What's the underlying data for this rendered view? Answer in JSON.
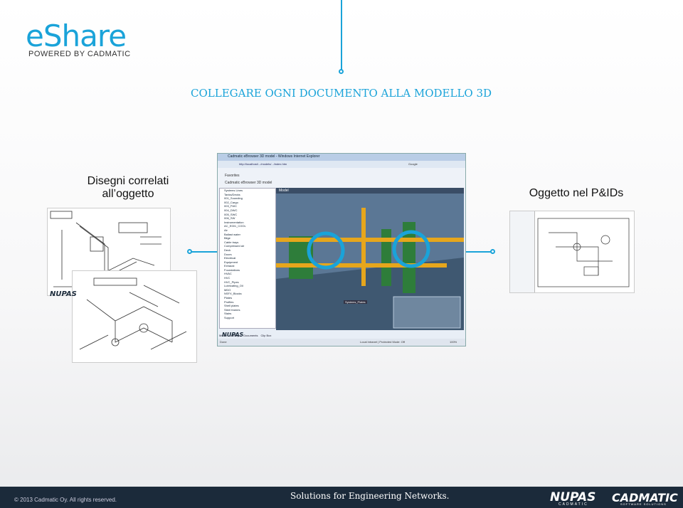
{
  "logo": {
    "name": "eShare",
    "tagline": "POWERED BY CADMATIC"
  },
  "title": "COLLEGARE OGNI DOCUMENTO ALLA MODELLO 3D",
  "left_label": "Disegni correlati\nall’oggetto",
  "right_label": "Oggetto nel P&IDs",
  "footer": {
    "copyright": "© 2013 Cadmatic Oy. All rights reserved.",
    "slogan": "Solutions for Engineering Networks.",
    "brand1": "NUPAS",
    "brand1_sub": "CADMATIC",
    "brand2": "CADMATIC",
    "brand2_sub": "SOFTWARE SOLUTIONS"
  },
  "screenshot": {
    "window_title": "Cadmatic eBrowser 3D model - Windows Internet Explorer",
    "url": "http://localhost/.../models/.../index.htm",
    "search_engine": "Google",
    "tab_label": "Cadmatic eBrowser 3D model",
    "favorites": "Favorites",
    "tree_items": [
      "Systems Lines",
      "Tanks/Decks",
      "001_Sounding",
      "002_Cargo",
      "003_FWC",
      "004_DWC",
      "005_SWC",
      "006_SW",
      "Instrumentation",
      "AC_E001_COOL",
      "Air",
      "Ballast water",
      "Bilge",
      "Cable trays",
      "Compressed air",
      "Deck",
      "Doors",
      "Electrical",
      "Equipment",
      "Exhaust",
      "Foundations",
      "HVAC",
      "HVC",
      "HVC_Pipes",
      "Lubricating_Oil",
      "MDO",
      "NSFX_Blocks",
      "Plates",
      "Profiles",
      "Shell plates",
      "Steel frames",
      "Stairs",
      "Support"
    ],
    "viewer_tab": "Model",
    "bottom_tabs": [
      "Model",
      "Markups",
      "Documents",
      "Clip Box"
    ],
    "status_left": "Done",
    "status_right": "Local intranet | Protected Mode: Off",
    "zoom": "100%",
    "scene_tag": "Systems_Plates"
  }
}
